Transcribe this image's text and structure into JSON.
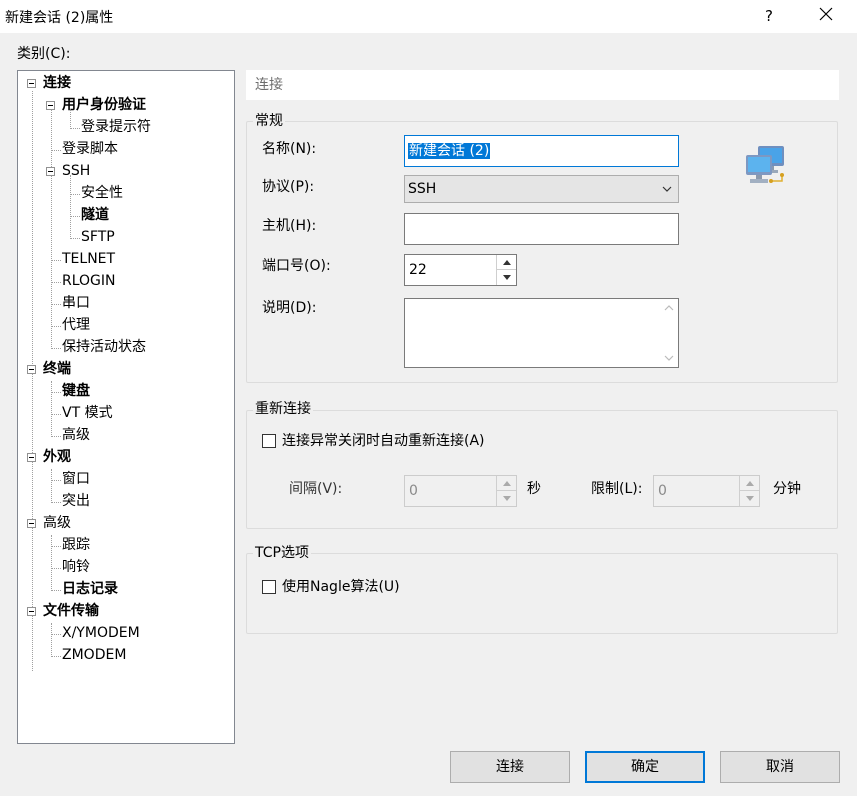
{
  "window": {
    "title": "新建会话 (2)属性",
    "help": "?"
  },
  "category_label": "类别(C):",
  "tree": [
    {
      "label": "连接",
      "bold": true
    },
    {
      "label": "用户身份验证",
      "bold": true
    },
    {
      "label": "登录提示符",
      "bold": false
    },
    {
      "label": "登录脚本",
      "bold": false
    },
    {
      "label": "SSH",
      "bold": false
    },
    {
      "label": "安全性",
      "bold": false
    },
    {
      "label": "隧道",
      "bold": true
    },
    {
      "label": "SFTP",
      "bold": false
    },
    {
      "label": "TELNET",
      "bold": false
    },
    {
      "label": "RLOGIN",
      "bold": false
    },
    {
      "label": "串口",
      "bold": false
    },
    {
      "label": "代理",
      "bold": false
    },
    {
      "label": "保持活动状态",
      "bold": false
    },
    {
      "label": "终端",
      "bold": true
    },
    {
      "label": "键盘",
      "bold": true
    },
    {
      "label": "VT 模式",
      "bold": false
    },
    {
      "label": "高级",
      "bold": false
    },
    {
      "label": "外观",
      "bold": true
    },
    {
      "label": "窗口",
      "bold": false
    },
    {
      "label": "突出",
      "bold": false
    },
    {
      "label": "高级",
      "bold": false
    },
    {
      "label": "跟踪",
      "bold": false
    },
    {
      "label": "响铃",
      "bold": false
    },
    {
      "label": "日志记录",
      "bold": true
    },
    {
      "label": "文件传输",
      "bold": true
    },
    {
      "label": "X/YMODEM",
      "bold": false
    },
    {
      "label": "ZMODEM",
      "bold": false
    }
  ],
  "section_header": "连接",
  "general": {
    "title": "常规",
    "name_label": "名称(N):",
    "name_value": "新建会话 (2)",
    "protocol_label": "协议(P):",
    "protocol_value": "SSH",
    "host_label": "主机(H):",
    "host_value": "",
    "port_label": "端口号(O):",
    "port_value": "22",
    "desc_label": "说明(D):",
    "desc_value": ""
  },
  "reconnect": {
    "title": "重新连接",
    "checkbox_label": "连接异常关闭时自动重新连接(A)",
    "checked": false,
    "interval_label": "间隔(V):",
    "interval_value": "0",
    "interval_unit": "秒",
    "limit_label": "限制(L):",
    "limit_value": "0",
    "limit_unit": "分钟"
  },
  "tcp": {
    "title": "TCP选项",
    "nagle_label": "使用Nagle算法(U)",
    "checked": false
  },
  "buttons": {
    "connect": "连接",
    "ok": "确定",
    "cancel": "取消"
  },
  "icons": {
    "computer": "network-computers-icon"
  },
  "colors": {
    "accent": "#0078d7",
    "background": "#f0f0f0"
  }
}
